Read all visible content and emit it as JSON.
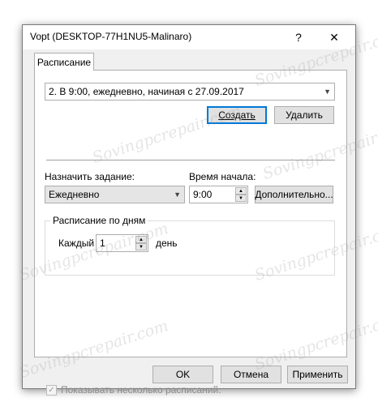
{
  "window": {
    "title": "Vopt (DESKTOP-77H1NU5-Malinaro)",
    "help_glyph": "?",
    "close_glyph": "✕"
  },
  "tabs": [
    {
      "label": "Расписание"
    }
  ],
  "schedule_select": {
    "value": "2. В 9:00, ежедневно, начиная с 27.09.2017"
  },
  "buttons": {
    "create": "Создать",
    "delete": "Удалить",
    "advanced": "Дополнительно...",
    "ok": "OK",
    "cancel": "Отмена",
    "apply": "Применить"
  },
  "task": {
    "label": "Назначить задание:",
    "value": "Ежедневно"
  },
  "start_time": {
    "label": "Время начала:",
    "value": "9:00"
  },
  "daily_group": {
    "legend": "Расписание по дням",
    "every_label": "Каждый",
    "every_value": "1",
    "unit_label": "день"
  },
  "multi_schedule": {
    "label": "Показывать несколько расписаний.",
    "checked": true
  },
  "watermark": {
    "text": "Sovingpcrepair.com"
  }
}
